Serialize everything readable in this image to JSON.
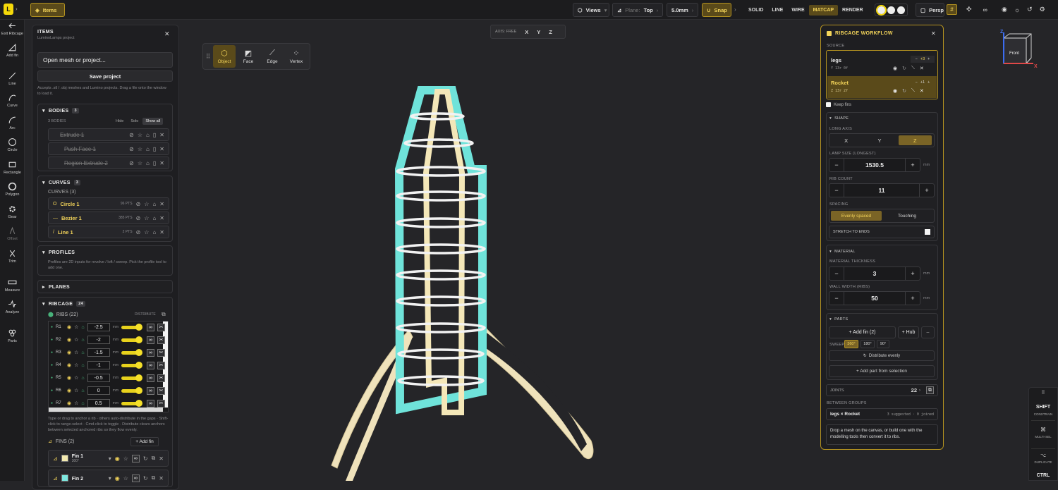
{
  "app": {
    "logo": "L",
    "items_button": "Items"
  },
  "topbar": {
    "views": "Views",
    "plane_label": "Plane:",
    "plane_value": "Top",
    "unit": "5.0mm",
    "snap": "Snap",
    "modes": [
      "SOLID",
      "LINE",
      "WIRE",
      "MATCAP",
      "RENDER"
    ],
    "active_mode": "MATCAP",
    "persp": "Persp"
  },
  "tools": [
    {
      "label": "Exit Ribcage",
      "icon": "arrow-left-icon"
    },
    {
      "label": "Add fin",
      "icon": "fin-icon"
    },
    {
      "label": "Line",
      "icon": "line-icon"
    },
    {
      "label": "Curve",
      "icon": "curve-icon"
    },
    {
      "label": "Arc",
      "icon": "arc-icon"
    },
    {
      "label": "Circle",
      "icon": "circle-icon"
    },
    {
      "label": "Rectangle",
      "icon": "rectangle-icon"
    },
    {
      "label": "Polygon",
      "icon": "polygon-icon"
    },
    {
      "label": "Gear",
      "icon": "gear-icon"
    },
    {
      "label": "Offset",
      "icon": "offset-icon"
    },
    {
      "label": "Trim",
      "icon": "scissors-icon"
    },
    {
      "label": "Measure",
      "icon": "ruler-icon"
    },
    {
      "label": "Analyze",
      "icon": "pulse-icon"
    },
    {
      "label": "Parts",
      "icon": "parts-icon"
    }
  ],
  "items_panel": {
    "title": "ITEMS",
    "subtitle": "LuminoLamps project",
    "open": "Open mesh or project...",
    "save": "Save project",
    "hint": "Accepts .stl / .obj meshes and Lumino projects. Drag a file onto the window to load it.",
    "bodies": {
      "title": "BODIES",
      "count": "3",
      "sub": "3 BODIES",
      "hide": "Hide",
      "solo": "Solo",
      "showall": "Show all",
      "items": [
        "Extrude 1",
        "Push Face 1",
        "Region Extrude 2"
      ]
    },
    "curves": {
      "title": "CURVES",
      "count": "3",
      "sub": "CURVES (3)",
      "items": [
        {
          "name": "Circle 1",
          "pts": "96 PTS",
          "glyph": "O"
        },
        {
          "name": "Bezier 1",
          "pts": "385 PTS",
          "glyph": "—"
        },
        {
          "name": "Line 1",
          "pts": "2 PTS",
          "glyph": "/"
        }
      ]
    },
    "profiles": {
      "title": "PROFILES",
      "desc": "Profiles are 2D inputs for revolve / loft / sweep. Pick the profile tool to add one."
    },
    "planes": {
      "title": "PLANES"
    },
    "ribcage": {
      "title": "RIBCAGE",
      "count": "24",
      "ribs_title": "RIBS (22)",
      "distribute": "DISTRIBUTE",
      "unit": "mm",
      "ribs": [
        {
          "id": "R1",
          "val": "-2.5"
        },
        {
          "id": "R2",
          "val": "-2"
        },
        {
          "id": "R3",
          "val": "-1.5"
        },
        {
          "id": "R4",
          "val": "-1"
        },
        {
          "id": "R5",
          "val": "-0.5"
        },
        {
          "id": "R6",
          "val": "0"
        },
        {
          "id": "R7",
          "val": "0.5"
        }
      ],
      "help": "Type or drag to anchor a rib · others auto-distribute in the gaps · Shift-click to range-select · Cmd-click to toggle · Distribute clears anchors between selected anchored ribs so they flow evenly.",
      "fins_title": "FINS (2)",
      "add_fin": "+ Add fin",
      "fins": [
        {
          "name": "Fin 1",
          "angle": "300°",
          "color": "#f3eab0"
        },
        {
          "name": "Fin 2",
          "angle": "",
          "color": "#7ee8e0"
        }
      ]
    }
  },
  "viewport": {
    "axis_label": "AXIS: FREE",
    "axes": [
      "X",
      "Y",
      "Z"
    ],
    "select_modes": [
      "Object",
      "Face",
      "Edge",
      "Vertex"
    ],
    "active_select": "Object"
  },
  "workflow": {
    "title": "RIBCAGE WORKFLOW",
    "source": "SOURCE",
    "sources": [
      {
        "name": "legs",
        "sub": "Y 13r 0f",
        "badge": "+3"
      },
      {
        "name": "Rocket",
        "sub": "Z 13r 2f",
        "badge": "+1"
      }
    ],
    "keep_fins": "Keep fins",
    "shape": {
      "title": "SHAPE",
      "long_axis": "LONG AXIS",
      "axes": [
        "X",
        "Y",
        "Z"
      ],
      "active_axis": "Z",
      "lamp_size_label": "LAMP SIZE (LONGEST)",
      "lamp_size": "1530.5",
      "unit": "mm",
      "rib_count_label": "RIB COUNT",
      "rib_count": "11",
      "spacing_label": "SPACING",
      "spacing": [
        "Evenly spaced",
        "Touching"
      ],
      "stretch": "STRETCH TO ENDS"
    },
    "material": {
      "title": "MATERIAL",
      "thickness_label": "MATERIAL THICKNESS",
      "thickness": "3",
      "wall_label": "WALL WIDTH (RIBS)",
      "wall": "50",
      "unit": "mm"
    },
    "parts": {
      "title": "PARTS",
      "add_fin": "+ Add fin (2)",
      "hub": "+ Hub",
      "minus": "–",
      "sweep_label": "SWEEP",
      "sweeps": [
        "360°",
        "180°",
        "90°"
      ],
      "distribute": "Distribute evenly",
      "add_part": "+ Add part from selection"
    },
    "joints": {
      "label": "JOINTS",
      "value": "22"
    },
    "between": {
      "label": "BETWEEN GROUPS",
      "pair": "legs × Rocket",
      "info": "3 suggested · 0 joined"
    },
    "drop_hint": "Drop a mesh on the canvas, or build one with the modelling tools then convert it to ribs."
  },
  "gizmo": {
    "face": "Front",
    "z": "Z",
    "x": "X"
  },
  "shortcuts": [
    {
      "key": "SHIFT",
      "desc": "CONSTRAIN",
      "icon": "grid-icon"
    },
    {
      "key": "MULTI-SEL",
      "desc": "",
      "icon": "command-icon"
    },
    {
      "key": "DUPLICATE",
      "desc": "",
      "icon": "option-icon"
    },
    {
      "key": "CTRL",
      "desc": "",
      "icon": ""
    }
  ]
}
